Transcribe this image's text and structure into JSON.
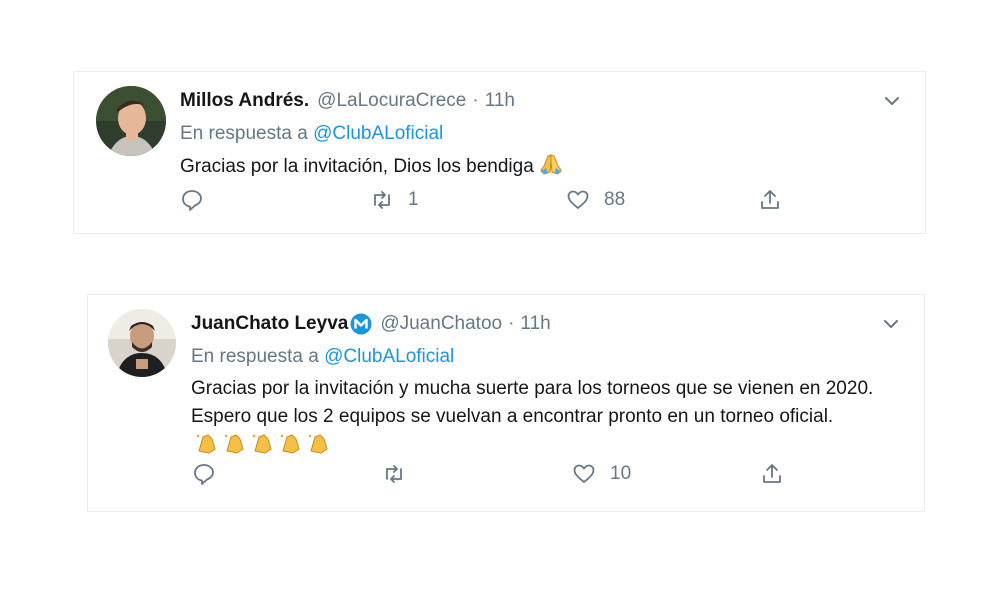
{
  "tweets": [
    {
      "display_name": "Millos Andrés.",
      "handle": "@LaLocuraCrece",
      "separator": "·",
      "time": "11h",
      "reply_prefix": "En respuesta a",
      "reply_mention": "@ClubALoficial",
      "text": "Gracias por la invitación, Dios los bendiga",
      "emoji": "folded-hands",
      "retweets": "1",
      "likes": "88",
      "verified": false
    },
    {
      "display_name": "JuanChato Leyva",
      "handle": "@JuanChatoo",
      "separator": "·",
      "time": "11h",
      "reply_prefix": "En respuesta a",
      "reply_mention": "@ClubALoficial",
      "text": "Gracias por la invitación y mucha suerte para los torneos que se vienen en 2020. Espero que los 2 equipos se vuelvan a encontrar pronto en un torneo oficial.",
      "emoji": "clapping-hands x5",
      "retweets": "",
      "likes": "10",
      "verified": true
    }
  ],
  "colors": {
    "text": "#14171a",
    "secondary": "#657786",
    "link": "#1b95e0",
    "border": "#e6ecf0"
  }
}
